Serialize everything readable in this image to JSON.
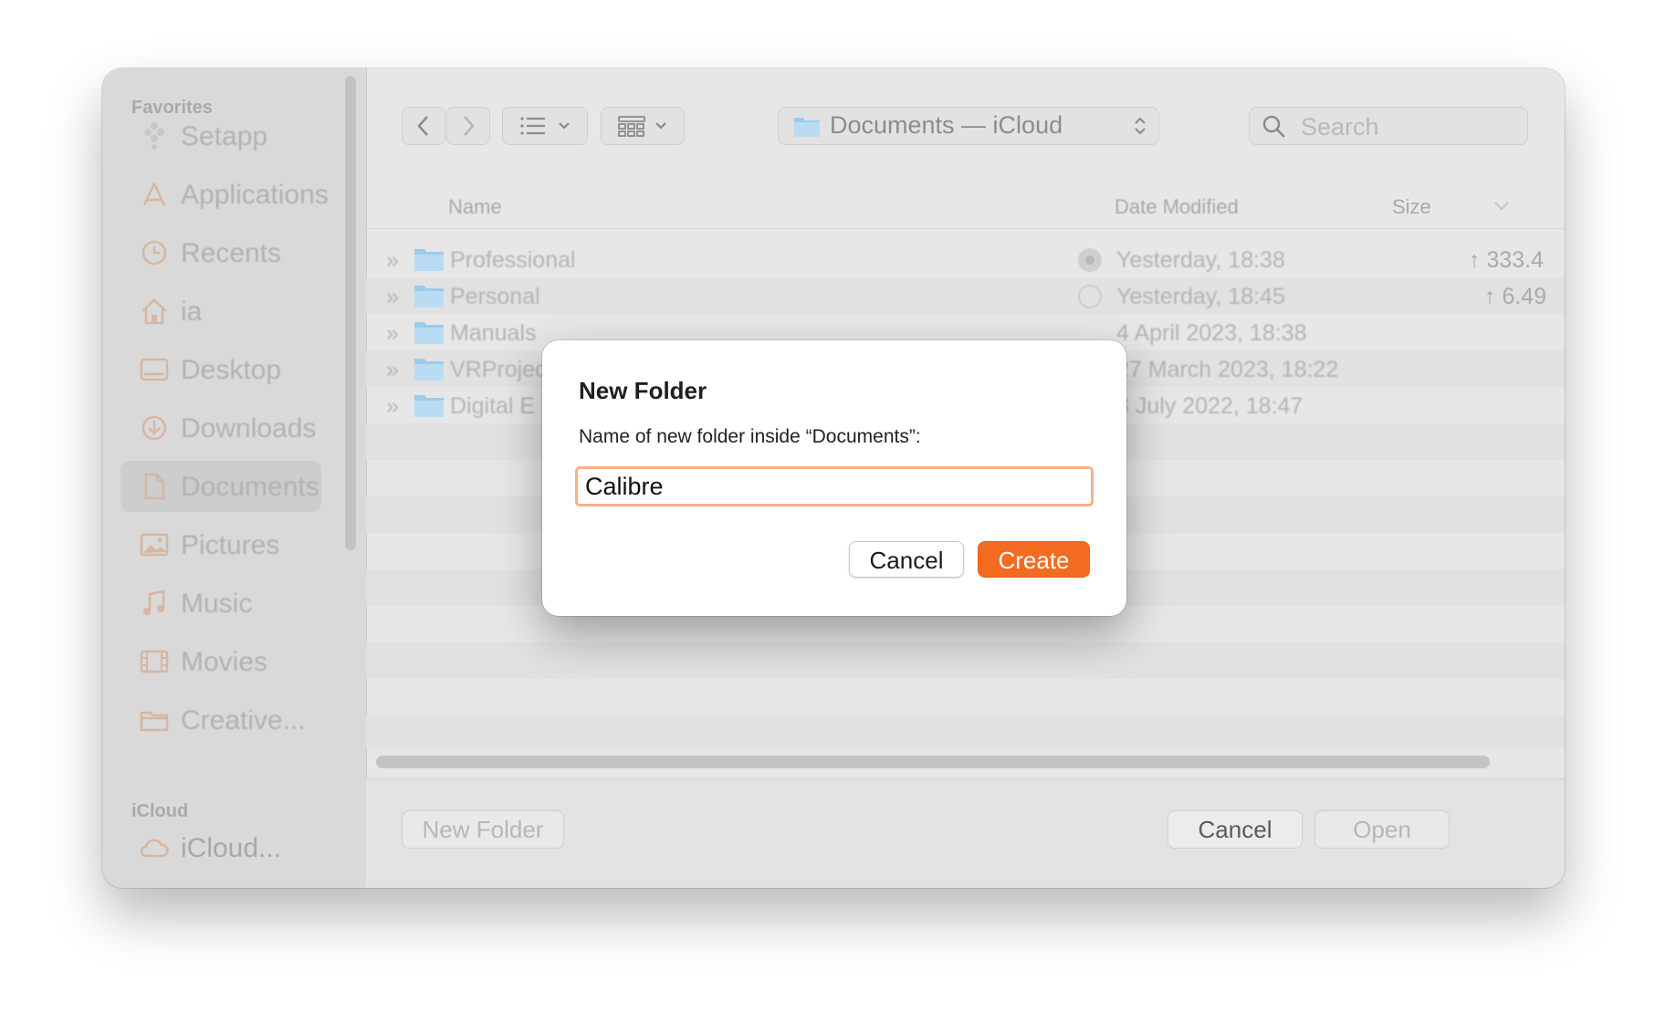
{
  "sidebar": {
    "favorites_label": "Favorites",
    "icloud_label": "iCloud",
    "items": [
      {
        "label": "Setapp",
        "icon": "setapp-icon"
      },
      {
        "label": "Applications",
        "icon": "applications-icon"
      },
      {
        "label": "Recents",
        "icon": "recents-clock-icon"
      },
      {
        "label": "ia",
        "icon": "home-icon"
      },
      {
        "label": "Desktop",
        "icon": "desktop-icon"
      },
      {
        "label": "Downloads",
        "icon": "downloads-icon"
      },
      {
        "label": "Documents",
        "icon": "document-icon"
      },
      {
        "label": "Pictures",
        "icon": "pictures-icon"
      },
      {
        "label": "Music",
        "icon": "music-icon"
      },
      {
        "label": "Movies",
        "icon": "movies-icon"
      },
      {
        "label": "Creative...",
        "icon": "folder-icon"
      }
    ],
    "icloud_item": {
      "label": "iCloud...",
      "icon": "cloud-icon"
    }
  },
  "toolbar": {
    "path_label": "Documents — iCloud",
    "search_placeholder": "Search"
  },
  "list": {
    "headers": {
      "name": "Name",
      "date": "Date Modified",
      "size": "Size"
    },
    "rows": [
      {
        "name": "Professional",
        "date": "Yesterday, 18:38",
        "size": "↑ 333.4"
      },
      {
        "name": "Personal",
        "date": "Yesterday, 18:45",
        "size": "↑ 6.49"
      },
      {
        "name": "Manuals",
        "date": "4 April 2023, 18:38",
        "size": ""
      },
      {
        "name": "VRProjects",
        "date": "27 March 2023, 18:22",
        "size": ""
      },
      {
        "name": "Digital E",
        "date": "8 July 2022, 18:47",
        "size": ""
      }
    ]
  },
  "bottom": {
    "new_folder": "New Folder",
    "cancel": "Cancel",
    "open": "Open"
  },
  "dialog": {
    "title": "New Folder",
    "prompt": "Name of new folder inside “Documents”:",
    "value": "Calibre",
    "cancel": "Cancel",
    "create": "Create"
  },
  "colors": {
    "accent": "#f26b21",
    "focus_ring": "#f6b08d",
    "folder_blue": "#8fc5e8"
  }
}
